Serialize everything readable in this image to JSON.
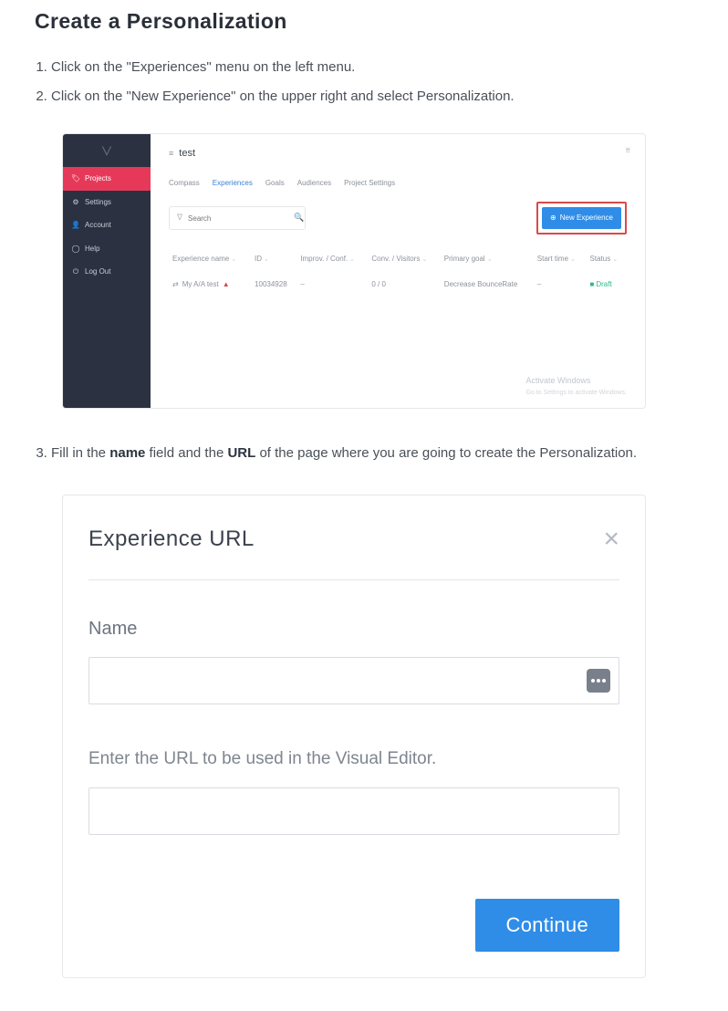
{
  "page_title": "Create a Personalization",
  "steps": {
    "s1": "Click on the \"Experiences\" menu on the left menu.",
    "s2": "Click on the \"New Experience\" on the upper right and select Personalization.",
    "s3_a": "Fill in the ",
    "s3_name": "name",
    "s3_b": " field and the ",
    "s3_url": "URL",
    "s3_c": " of the page where you are going to create the Personalization."
  },
  "app": {
    "crumb_title": "test",
    "sidebar": {
      "projects": "Projects",
      "settings": "Settings",
      "account": "Account",
      "help": "Help",
      "logout": "Log Out"
    },
    "tabs": {
      "compass": "Compass",
      "experiences": "Experiences",
      "goals": "Goals",
      "audiences": "Audiences",
      "project_settings": "Project Settings"
    },
    "search_placeholder": "Search",
    "new_experience": "New Experience",
    "table": {
      "headers": {
        "name": "Experience name",
        "id": "ID",
        "improv": "Improv. / Conf.",
        "conv": "Conv. / Visitors",
        "goal": "Primary goal",
        "start": "Start time",
        "status": "Status"
      },
      "row": {
        "name": "My A/A test",
        "id": "10034928",
        "improv": "–",
        "conv": "0 / 0",
        "goal": "Decrease BounceRate",
        "start": "–",
        "status": "Draft"
      }
    },
    "activate": {
      "title": "Activate Windows",
      "sub": "Go to Settings to activate Windows."
    }
  },
  "modal": {
    "title": "Experience URL",
    "name_label": "Name",
    "hint": "Enter the URL to be used in the Visual Editor.",
    "continue": "Continue"
  }
}
